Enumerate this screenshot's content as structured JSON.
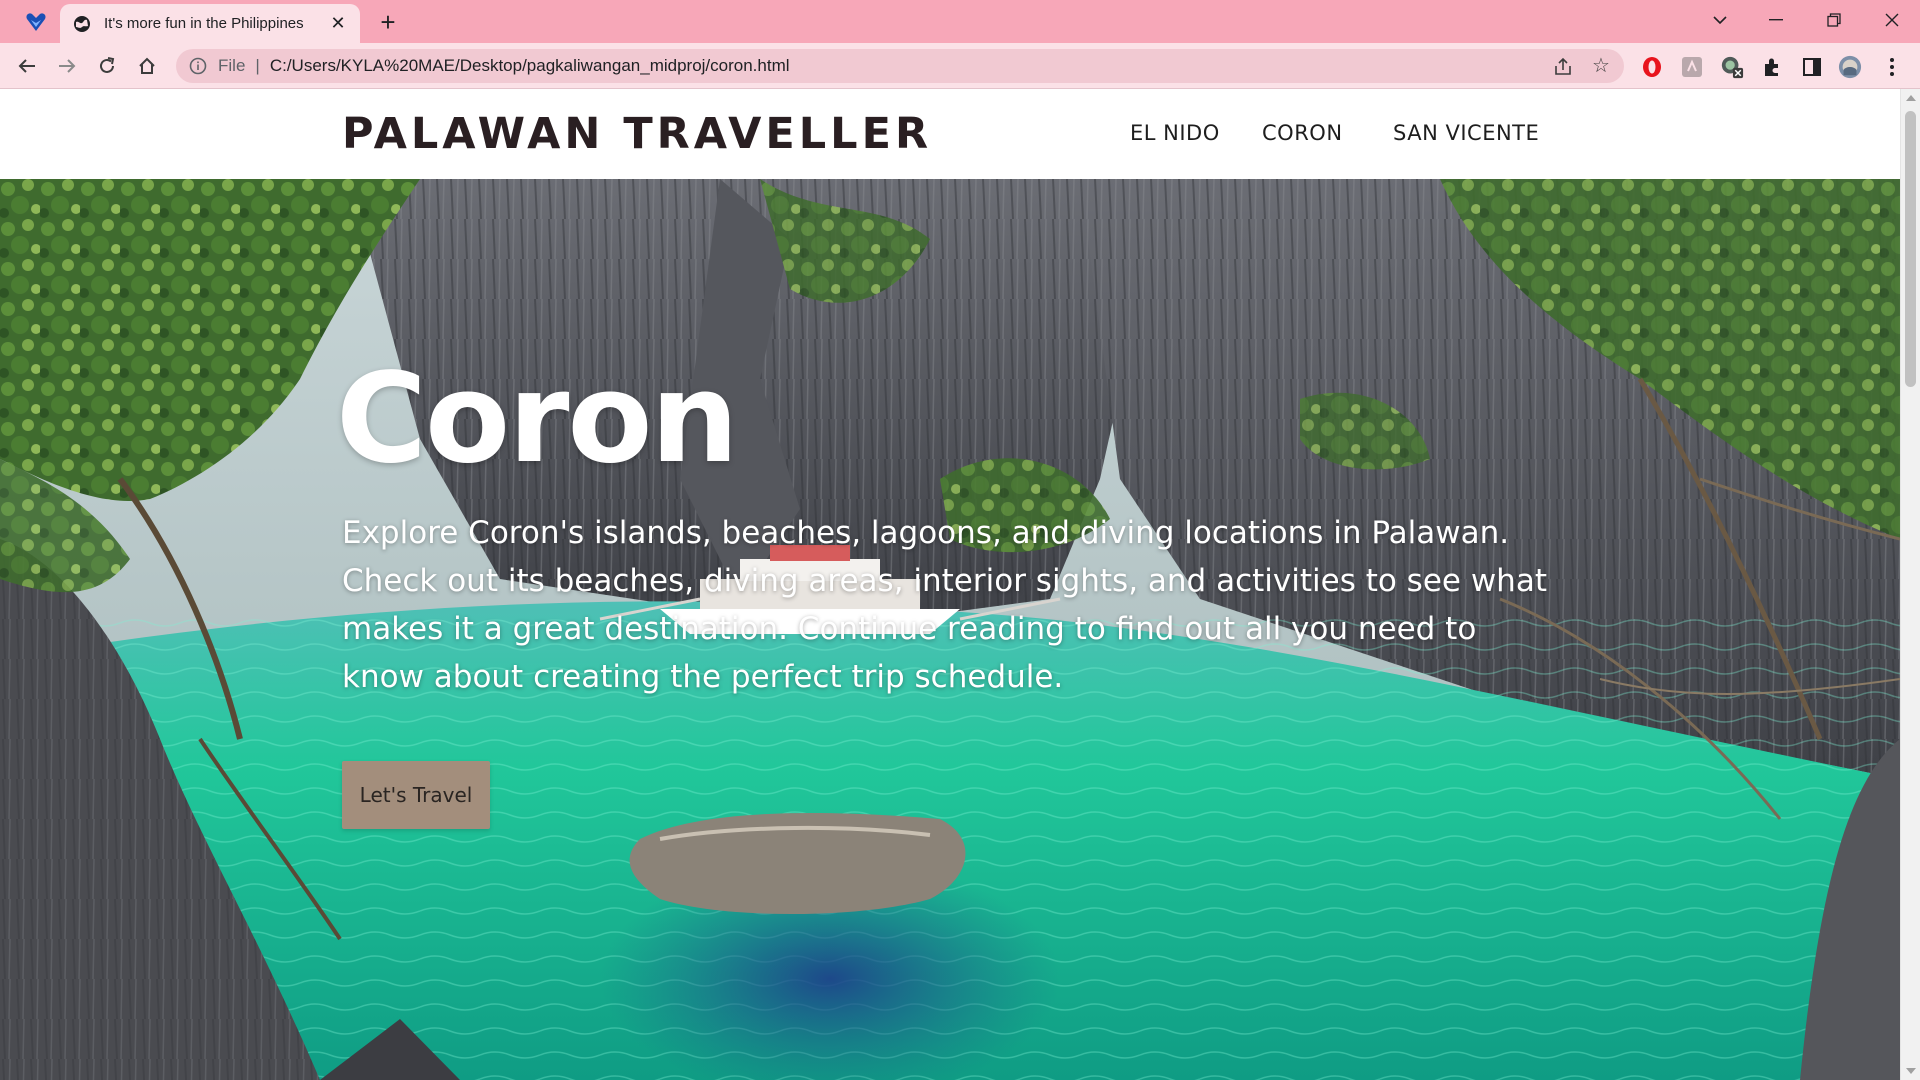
{
  "browser": {
    "tab": {
      "title": "It's more fun in the Philippines"
    },
    "address": {
      "scheme_label": "File",
      "separator": "|",
      "url": "C:/Users/KYLA%20MAE/Desktop/pagkaliwangan_midproj/coron.html"
    },
    "colors": {
      "tabstrip": "#f7a7b8",
      "toolbar": "#fbe1e7",
      "omnibox": "#f1c9d2"
    }
  },
  "site": {
    "logo": "PALAWAN TRAVELLER",
    "nav": [
      {
        "label": "EL NIDO"
      },
      {
        "label": "CORON"
      },
      {
        "label": "SAN VICENTE"
      }
    ]
  },
  "hero": {
    "title": "Coron",
    "description": "Explore Coron's islands, beaches, lagoons, and diving locations in Palawan. Check out its beaches, diving areas, interior sights, and activities to see what makes it a great destination. Continue reading to find out all you need to know about creating the perfect trip schedule.",
    "cta_label": "Let's Travel",
    "colors": {
      "cta": "#a38e7c",
      "water": "#1fc79a",
      "rock": "#5a5a5e"
    }
  }
}
